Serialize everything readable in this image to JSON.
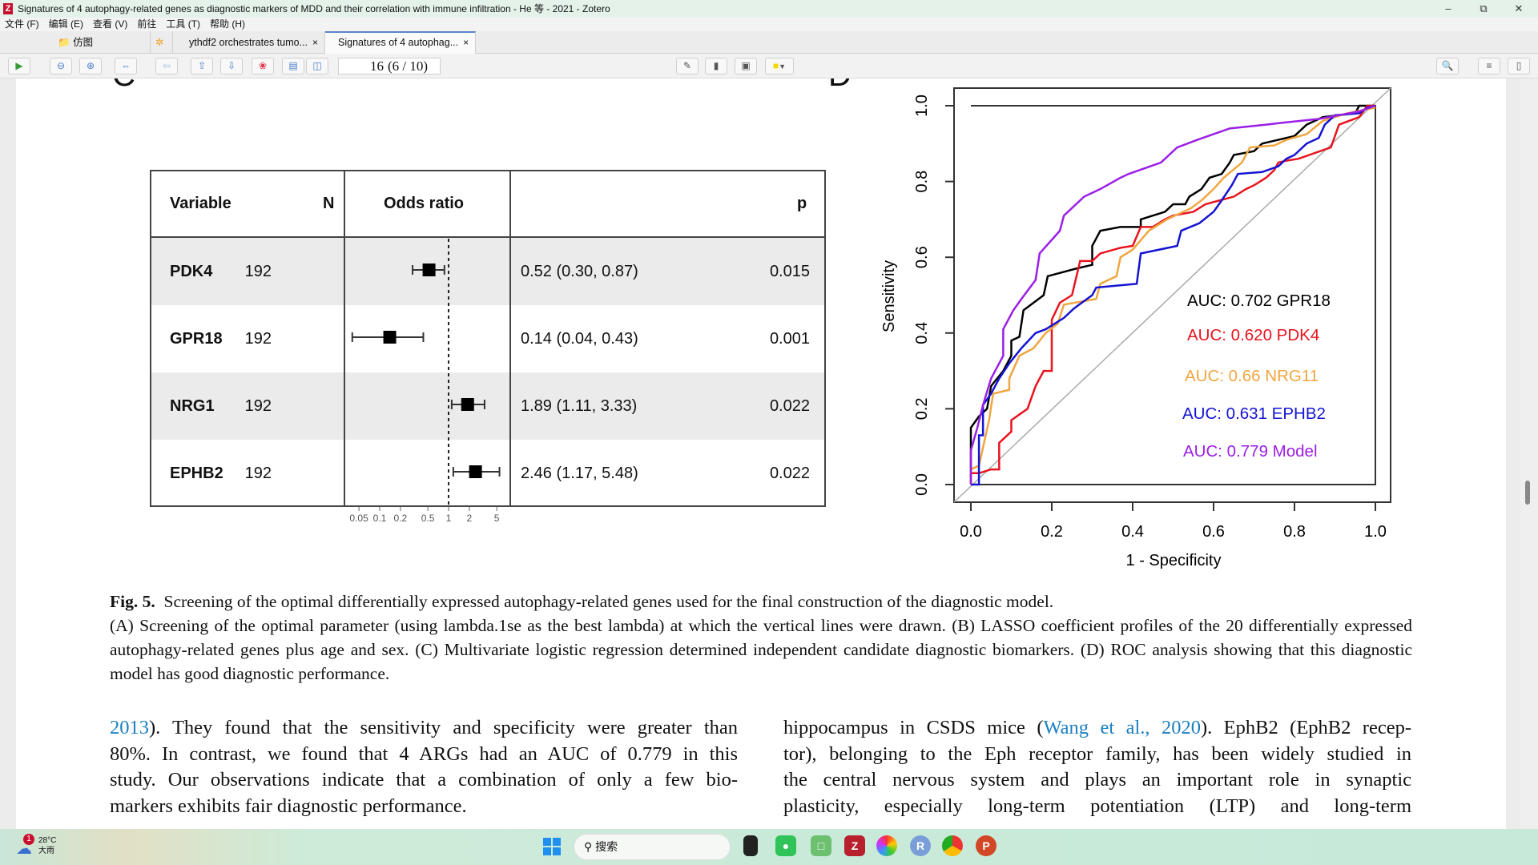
{
  "window": {
    "title": "Signatures of 4 autophagy-related genes as diagnostic markers of MDD and their correlation with immune infiltration - He 等 - 2021 - Zotero",
    "app_logo": "Z"
  },
  "menu": [
    "文件 (F)",
    "编辑 (E)",
    "查看 (V)",
    "前往",
    "工具 (T)",
    "帮助 (H)"
  ],
  "tabs": [
    {
      "label": "仿图",
      "icon": "folder-icon"
    },
    {
      "label": "ythdf2 orchestrates tumo...",
      "close": "×"
    },
    {
      "label": "Signatures of 4 autophag...",
      "close": "×",
      "active": true
    }
  ],
  "toolbar": {
    "page_input": "16",
    "page_count": "(6 / 10)",
    "highlight_color": "#f5d800"
  },
  "figure": {
    "panel_c_label": "C",
    "panel_d_label": "D"
  },
  "forest": {
    "headers": {
      "variable": "Variable",
      "n": "N",
      "or": "Odds ratio",
      "p": "p"
    },
    "rows": [
      {
        "variable": "PDK4",
        "n": "192",
        "or": 0.52,
        "lo": 0.3,
        "hi": 0.87,
        "ci_text": "0.52 (0.30, 0.87)",
        "p": "0.015"
      },
      {
        "variable": "GPR18",
        "n": "192",
        "or": 0.14,
        "lo": 0.04,
        "hi": 0.43,
        "ci_text": "0.14 (0.04, 0.43)",
        "p": "0.001"
      },
      {
        "variable": "NRG1",
        "n": "192",
        "or": 1.89,
        "lo": 1.11,
        "hi": 3.33,
        "ci_text": "1.89 (1.11, 3.33)",
        "p": "0.022"
      },
      {
        "variable": "EPHB2",
        "n": "192",
        "or": 2.46,
        "lo": 1.17,
        "hi": 5.48,
        "ci_text": "2.46 (1.17, 5.48)",
        "p": "0.022"
      }
    ],
    "axis_ticks": [
      "0.05",
      "0.1",
      "0.2",
      "0.5",
      "1",
      "2",
      "5"
    ],
    "scale": "log"
  },
  "chart_data": {
    "type": "line",
    "xlabel": "1 - Specificity",
    "ylabel": "Sensitivity",
    "xlim": [
      0,
      1
    ],
    "ylim": [
      0,
      1
    ],
    "xticks": [
      "0.0",
      "0.2",
      "0.4",
      "0.6",
      "0.8",
      "1.0"
    ],
    "yticks": [
      "0.0",
      "0.2",
      "0.4",
      "0.6",
      "0.8",
      "1.0"
    ],
    "diagonal_color": "#aaaaaa",
    "series": [
      {
        "name": "AUC: 0.702 GPR18",
        "color": "#000000",
        "points": [
          [
            0,
            0
          ],
          [
            0,
            0.15
          ],
          [
            0.02,
            0.18
          ],
          [
            0.04,
            0.2
          ],
          [
            0.05,
            0.26
          ],
          [
            0.08,
            0.3
          ],
          [
            0.1,
            0.34
          ],
          [
            0.1,
            0.38
          ],
          [
            0.12,
            0.39
          ],
          [
            0.13,
            0.46
          ],
          [
            0.18,
            0.5
          ],
          [
            0.19,
            0.55
          ],
          [
            0.26,
            0.57
          ],
          [
            0.3,
            0.58
          ],
          [
            0.3,
            0.63
          ],
          [
            0.32,
            0.67
          ],
          [
            0.37,
            0.68
          ],
          [
            0.42,
            0.68
          ],
          [
            0.42,
            0.7
          ],
          [
            0.48,
            0.72
          ],
          [
            0.5,
            0.74
          ],
          [
            0.53,
            0.74
          ],
          [
            0.54,
            0.76
          ],
          [
            0.57,
            0.78
          ],
          [
            0.59,
            0.81
          ],
          [
            0.62,
            0.82
          ],
          [
            0.64,
            0.85
          ],
          [
            0.65,
            0.87
          ],
          [
            0.7,
            0.88
          ],
          [
            0.72,
            0.9
          ],
          [
            0.76,
            0.91
          ],
          [
            0.8,
            0.92
          ],
          [
            0.83,
            0.95
          ],
          [
            0.87,
            0.97
          ],
          [
            0.95,
            0.98
          ],
          [
            0.96,
            1
          ],
          [
            1,
            1
          ]
        ]
      },
      {
        "name": "AUC: 0.620 PDK4",
        "color": "#e8141e",
        "points": [
          [
            0,
            0
          ],
          [
            0,
            0.03
          ],
          [
            0.02,
            0.03
          ],
          [
            0.05,
            0.04
          ],
          [
            0.07,
            0.04
          ],
          [
            0.07,
            0.11
          ],
          [
            0.1,
            0.14
          ],
          [
            0.1,
            0.17
          ],
          [
            0.14,
            0.2
          ],
          [
            0.16,
            0.26
          ],
          [
            0.18,
            0.3
          ],
          [
            0.2,
            0.3
          ],
          [
            0.2,
            0.435
          ],
          [
            0.22,
            0.48
          ],
          [
            0.25,
            0.5
          ],
          [
            0.27,
            0.59
          ],
          [
            0.3,
            0.59
          ],
          [
            0.32,
            0.61
          ],
          [
            0.37,
            0.625
          ],
          [
            0.4,
            0.63
          ],
          [
            0.42,
            0.68
          ],
          [
            0.45,
            0.68
          ],
          [
            0.48,
            0.7
          ],
          [
            0.5,
            0.71
          ],
          [
            0.55,
            0.72
          ],
          [
            0.58,
            0.74
          ],
          [
            0.65,
            0.76
          ],
          [
            0.68,
            0.78
          ],
          [
            0.7,
            0.79
          ],
          [
            0.73,
            0.81
          ],
          [
            0.75,
            0.83
          ],
          [
            0.76,
            0.85
          ],
          [
            0.78,
            0.855
          ],
          [
            0.81,
            0.86
          ],
          [
            0.89,
            0.89
          ],
          [
            0.91,
            0.95
          ],
          [
            0.96,
            0.97
          ],
          [
            0.98,
            1
          ],
          [
            1,
            1
          ]
        ]
      },
      {
        "name": "AUC: 0.66 NRG11",
        "color": "#f0a640",
        "points": [
          [
            0,
            0
          ],
          [
            0,
            0.04
          ],
          [
            0.02,
            0.05
          ],
          [
            0.045,
            0.17
          ],
          [
            0.055,
            0.24
          ],
          [
            0.095,
            0.25
          ],
          [
            0.095,
            0.28
          ],
          [
            0.12,
            0.34
          ],
          [
            0.155,
            0.36
          ],
          [
            0.185,
            0.4
          ],
          [
            0.215,
            0.425
          ],
          [
            0.23,
            0.475
          ],
          [
            0.31,
            0.49
          ],
          [
            0.32,
            0.53
          ],
          [
            0.36,
            0.55
          ],
          [
            0.37,
            0.6
          ],
          [
            0.4,
            0.62
          ],
          [
            0.44,
            0.67
          ],
          [
            0.485,
            0.7
          ],
          [
            0.545,
            0.73
          ],
          [
            0.57,
            0.75
          ],
          [
            0.6,
            0.78
          ],
          [
            0.625,
            0.81
          ],
          [
            0.67,
            0.85
          ],
          [
            0.69,
            0.89
          ],
          [
            0.75,
            0.895
          ],
          [
            0.78,
            0.91
          ],
          [
            0.83,
            0.925
          ],
          [
            0.87,
            0.96
          ],
          [
            0.93,
            0.98
          ],
          [
            1,
            0.995
          ]
        ]
      },
      {
        "name": "AUC: 0.631 EPHB2",
        "color": "#1414d2",
        "points": [
          [
            0,
            0
          ],
          [
            0.02,
            0.0
          ],
          [
            0.02,
            0.13
          ],
          [
            0.03,
            0.13
          ],
          [
            0.03,
            0.21
          ],
          [
            0.05,
            0.24
          ],
          [
            0.07,
            0.28
          ],
          [
            0.095,
            0.32
          ],
          [
            0.125,
            0.36
          ],
          [
            0.16,
            0.4
          ],
          [
            0.185,
            0.41
          ],
          [
            0.23,
            0.44
          ],
          [
            0.255,
            0.465
          ],
          [
            0.3,
            0.5
          ],
          [
            0.31,
            0.52
          ],
          [
            0.41,
            0.53
          ],
          [
            0.42,
            0.61
          ],
          [
            0.51,
            0.63
          ],
          [
            0.52,
            0.67
          ],
          [
            0.565,
            0.69
          ],
          [
            0.6,
            0.72
          ],
          [
            0.62,
            0.75
          ],
          [
            0.645,
            0.79
          ],
          [
            0.66,
            0.82
          ],
          [
            0.72,
            0.825
          ],
          [
            0.76,
            0.84
          ],
          [
            0.78,
            0.86
          ],
          [
            0.8,
            0.87
          ],
          [
            0.83,
            0.9
          ],
          [
            0.86,
            0.915
          ],
          [
            0.875,
            0.95
          ],
          [
            0.9,
            0.975
          ],
          [
            0.96,
            0.98
          ],
          [
            0.98,
            0.995
          ],
          [
            1,
            1
          ]
        ]
      },
      {
        "name": "AUC: 0.779 Model",
        "color": "#9b1ee6",
        "points": [
          [
            0,
            0
          ],
          [
            0,
            0.09
          ],
          [
            0.016,
            0.15
          ],
          [
            0.03,
            0.21
          ],
          [
            0.05,
            0.28
          ],
          [
            0.08,
            0.34
          ],
          [
            0.08,
            0.41
          ],
          [
            0.105,
            0.46
          ],
          [
            0.125,
            0.49
          ],
          [
            0.16,
            0.54
          ],
          [
            0.17,
            0.61
          ],
          [
            0.22,
            0.67
          ],
          [
            0.23,
            0.71
          ],
          [
            0.28,
            0.76
          ],
          [
            0.32,
            0.78
          ],
          [
            0.37,
            0.81
          ],
          [
            0.39,
            0.82
          ],
          [
            0.47,
            0.85
          ],
          [
            0.51,
            0.89
          ],
          [
            0.56,
            0.91
          ],
          [
            0.64,
            0.94
          ],
          [
            0.73,
            0.95
          ],
          [
            0.77,
            0.955
          ],
          [
            0.86,
            0.965
          ],
          [
            0.96,
            0.985
          ],
          [
            1,
            1
          ]
        ]
      }
    ]
  },
  "caption": {
    "label": "Fig. 5.",
    "title": "Screening of the optimal differentially expressed autophagy-related genes used for the final construction of the diagnostic model.",
    "text": "(A) Screening of the optimal parameter (using lambda.1se as the best lambda) at which the vertical lines were drawn. (B) LASSO coefficient profiles of the 20 differentially expressed autophagy-related genes plus age and sex. (C) Multivariate logistic regression determined independent candidate diagnostic biomarkers. (D) ROC analysis showing that this diagnostic model has good diagnostic performance."
  },
  "body": {
    "left": {
      "link": "2013",
      "lines": [
        "). They found that the sensitivity and specificity were greater than",
        "80%. In contrast, we found that 4 ARGs had an AUC of 0.779 in this",
        "study. Our observations indicate that a combination of only a few bio-",
        "markers exhibits fair diagnostic performance."
      ]
    },
    "right": {
      "l1a": "hippocampus in CSDS mice (",
      "l1link": "Wang et al., 2020",
      "l1b": "). EphB2 (EphB2 recep-",
      "lines": [
        "tor), belonging to the Eph receptor family, has been widely studied in",
        "the central nervous system and plays an important role in synaptic",
        "plasticity, especially long-term potentiation (LTP) and long-term"
      ]
    }
  },
  "taskbar": {
    "weather_temp": "28°C",
    "weather_desc": "大雨",
    "weather_badge": "1",
    "search_placeholder": "搜索"
  }
}
